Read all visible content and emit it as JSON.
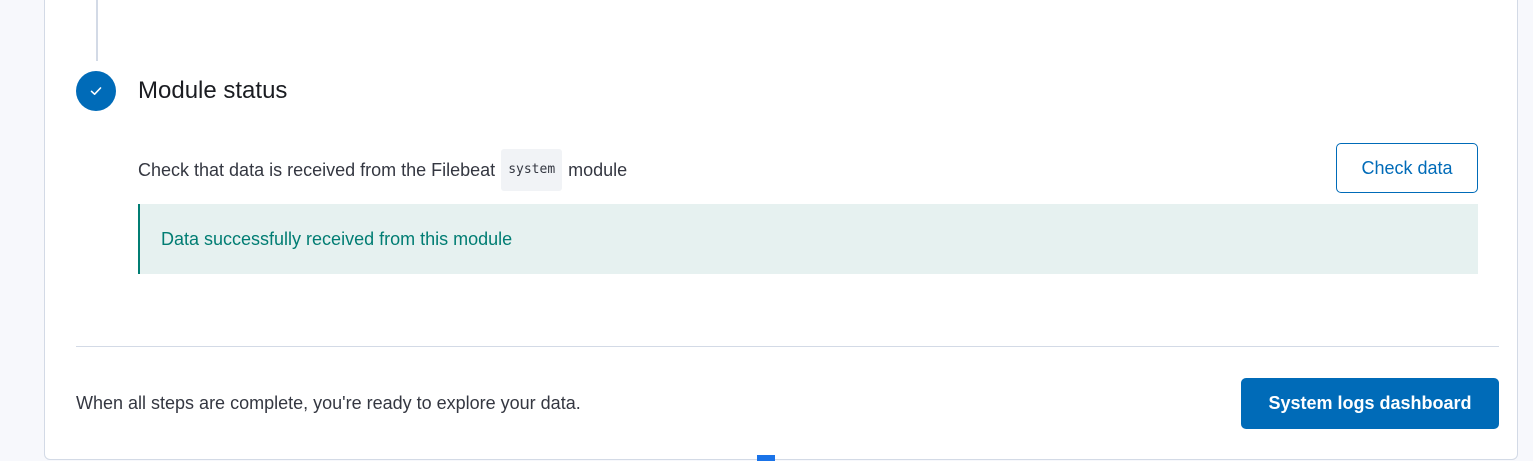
{
  "step": {
    "title": "Module status",
    "description_before": "Check that data is received from the Filebeat",
    "module_code": "system",
    "description_after": "module",
    "check_button_label": "Check data",
    "success_message": "Data successfully received from this module"
  },
  "footer": {
    "text": "When all steps are complete, you're ready to explore your data.",
    "dashboard_button_label": "System logs dashboard"
  },
  "colors": {
    "primary": "#006bb8",
    "success": "#017d73",
    "success_bg": "#e6f1f0"
  },
  "icons": {
    "step_status": "check-icon"
  }
}
